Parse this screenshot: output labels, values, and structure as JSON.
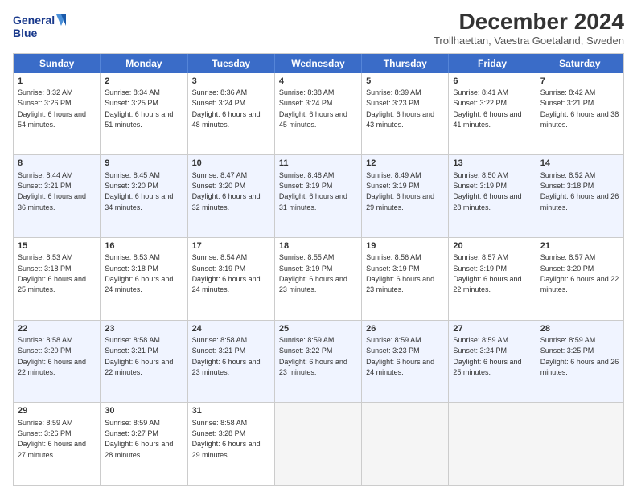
{
  "logo": {
    "line1": "General",
    "line2": "Blue"
  },
  "title": "December 2024",
  "subtitle": "Trollhaettan, Vaestra Goetaland, Sweden",
  "days": [
    "Sunday",
    "Monday",
    "Tuesday",
    "Wednesday",
    "Thursday",
    "Friday",
    "Saturday"
  ],
  "weeks": [
    [
      {
        "day": "1",
        "sunrise": "8:32 AM",
        "sunset": "3:26 PM",
        "daylight": "6 hours and 54 minutes."
      },
      {
        "day": "2",
        "sunrise": "8:34 AM",
        "sunset": "3:25 PM",
        "daylight": "6 hours and 51 minutes."
      },
      {
        "day": "3",
        "sunrise": "8:36 AM",
        "sunset": "3:24 PM",
        "daylight": "6 hours and 48 minutes."
      },
      {
        "day": "4",
        "sunrise": "8:38 AM",
        "sunset": "3:24 PM",
        "daylight": "6 hours and 45 minutes."
      },
      {
        "day": "5",
        "sunrise": "8:39 AM",
        "sunset": "3:23 PM",
        "daylight": "6 hours and 43 minutes."
      },
      {
        "day": "6",
        "sunrise": "8:41 AM",
        "sunset": "3:22 PM",
        "daylight": "6 hours and 41 minutes."
      },
      {
        "day": "7",
        "sunrise": "8:42 AM",
        "sunset": "3:21 PM",
        "daylight": "6 hours and 38 minutes."
      }
    ],
    [
      {
        "day": "8",
        "sunrise": "8:44 AM",
        "sunset": "3:21 PM",
        "daylight": "6 hours and 36 minutes."
      },
      {
        "day": "9",
        "sunrise": "8:45 AM",
        "sunset": "3:20 PM",
        "daylight": "6 hours and 34 minutes."
      },
      {
        "day": "10",
        "sunrise": "8:47 AM",
        "sunset": "3:20 PM",
        "daylight": "6 hours and 32 minutes."
      },
      {
        "day": "11",
        "sunrise": "8:48 AM",
        "sunset": "3:19 PM",
        "daylight": "6 hours and 31 minutes."
      },
      {
        "day": "12",
        "sunrise": "8:49 AM",
        "sunset": "3:19 PM",
        "daylight": "6 hours and 29 minutes."
      },
      {
        "day": "13",
        "sunrise": "8:50 AM",
        "sunset": "3:19 PM",
        "daylight": "6 hours and 28 minutes."
      },
      {
        "day": "14",
        "sunrise": "8:52 AM",
        "sunset": "3:18 PM",
        "daylight": "6 hours and 26 minutes."
      }
    ],
    [
      {
        "day": "15",
        "sunrise": "8:53 AM",
        "sunset": "3:18 PM",
        "daylight": "6 hours and 25 minutes."
      },
      {
        "day": "16",
        "sunrise": "8:53 AM",
        "sunset": "3:18 PM",
        "daylight": "6 hours and 24 minutes."
      },
      {
        "day": "17",
        "sunrise": "8:54 AM",
        "sunset": "3:19 PM",
        "daylight": "6 hours and 24 minutes."
      },
      {
        "day": "18",
        "sunrise": "8:55 AM",
        "sunset": "3:19 PM",
        "daylight": "6 hours and 23 minutes."
      },
      {
        "day": "19",
        "sunrise": "8:56 AM",
        "sunset": "3:19 PM",
        "daylight": "6 hours and 23 minutes."
      },
      {
        "day": "20",
        "sunrise": "8:57 AM",
        "sunset": "3:19 PM",
        "daylight": "6 hours and 22 minutes."
      },
      {
        "day": "21",
        "sunrise": "8:57 AM",
        "sunset": "3:20 PM",
        "daylight": "6 hours and 22 minutes."
      }
    ],
    [
      {
        "day": "22",
        "sunrise": "8:58 AM",
        "sunset": "3:20 PM",
        "daylight": "6 hours and 22 minutes."
      },
      {
        "day": "23",
        "sunrise": "8:58 AM",
        "sunset": "3:21 PM",
        "daylight": "6 hours and 22 minutes."
      },
      {
        "day": "24",
        "sunrise": "8:58 AM",
        "sunset": "3:21 PM",
        "daylight": "6 hours and 23 minutes."
      },
      {
        "day": "25",
        "sunrise": "8:59 AM",
        "sunset": "3:22 PM",
        "daylight": "6 hours and 23 minutes."
      },
      {
        "day": "26",
        "sunrise": "8:59 AM",
        "sunset": "3:23 PM",
        "daylight": "6 hours and 24 minutes."
      },
      {
        "day": "27",
        "sunrise": "8:59 AM",
        "sunset": "3:24 PM",
        "daylight": "6 hours and 25 minutes."
      },
      {
        "day": "28",
        "sunrise": "8:59 AM",
        "sunset": "3:25 PM",
        "daylight": "6 hours and 26 minutes."
      }
    ],
    [
      {
        "day": "29",
        "sunrise": "8:59 AM",
        "sunset": "3:26 PM",
        "daylight": "6 hours and 27 minutes."
      },
      {
        "day": "30",
        "sunrise": "8:59 AM",
        "sunset": "3:27 PM",
        "daylight": "6 hours and 28 minutes."
      },
      {
        "day": "31",
        "sunrise": "8:58 AM",
        "sunset": "3:28 PM",
        "daylight": "6 hours and 29 minutes."
      },
      null,
      null,
      null,
      null
    ]
  ]
}
